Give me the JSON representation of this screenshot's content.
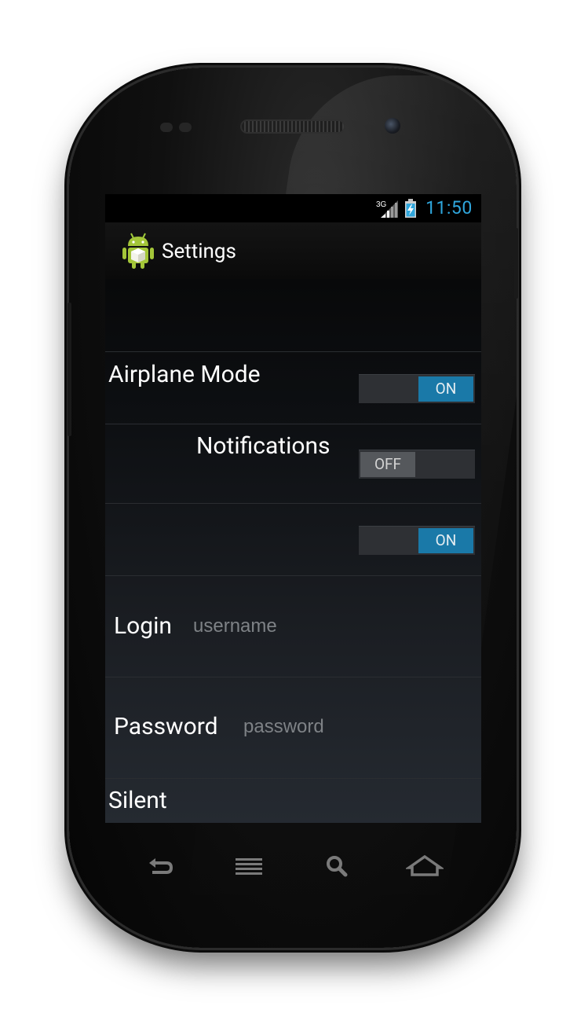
{
  "status_bar": {
    "network": "3G",
    "time": "11:50"
  },
  "action_bar": {
    "title": "Settings",
    "icon": "android-robot-icon"
  },
  "settings": {
    "airplane_mode": {
      "label": "Airplane Mode",
      "toggle": "ON"
    },
    "notifications": {
      "label": "Notifications",
      "toggle": "OFF"
    },
    "unlabeled_toggle": {
      "label": "",
      "toggle": "ON"
    },
    "login": {
      "label": "Login",
      "placeholder": "username",
      "value": ""
    },
    "password": {
      "label": "Password",
      "placeholder": "password",
      "value": ""
    },
    "silent": {
      "label": "Silent"
    }
  },
  "nav_bar": {
    "buttons": [
      "back-icon",
      "menu-icon",
      "search-icon",
      "home-icon"
    ]
  },
  "colors": {
    "accent": "#2fa6dc",
    "toggle_on": "#1a79a8",
    "toggle_off": "#55585c"
  }
}
